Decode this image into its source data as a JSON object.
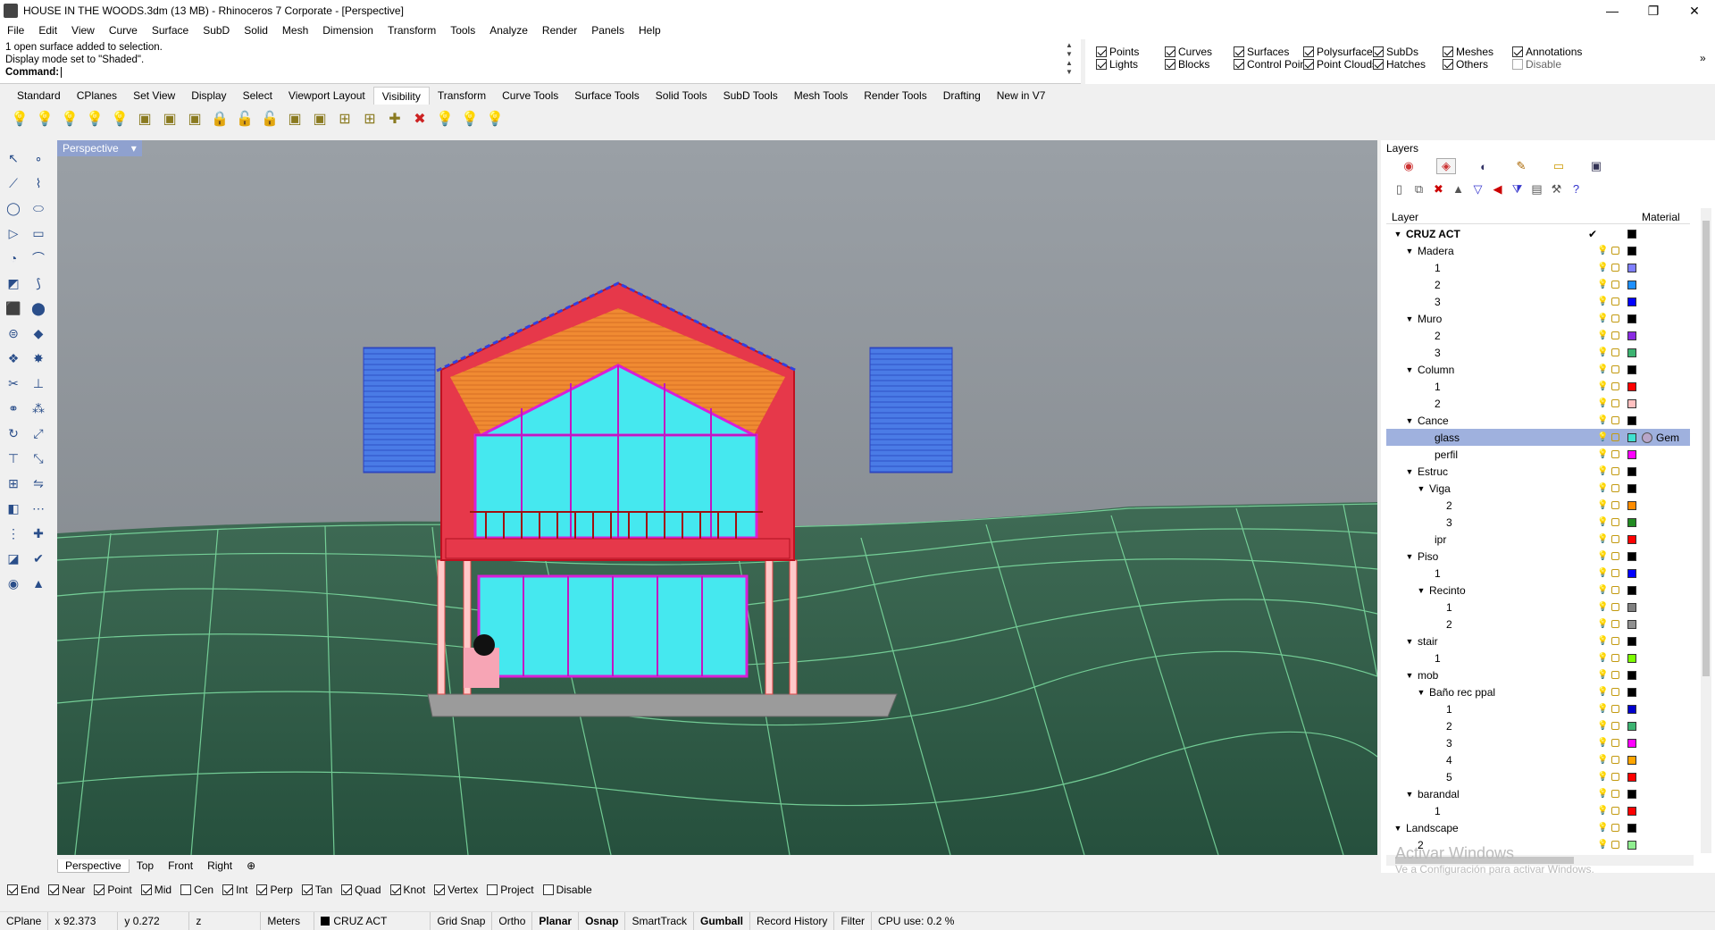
{
  "window": {
    "title": "HOUSE IN THE WOODS.3dm (13 MB) - Rhinoceros 7 Corporate - [Perspective]",
    "controls": [
      "—",
      "❐",
      "✕"
    ]
  },
  "menu": [
    "File",
    "Edit",
    "View",
    "Curve",
    "Surface",
    "SubD",
    "Solid",
    "Mesh",
    "Dimension",
    "Transform",
    "Tools",
    "Analyze",
    "Render",
    "Panels",
    "Help"
  ],
  "command": {
    "history": [
      "1 open surface added to selection.",
      "Display mode set to \"Shaded\"."
    ],
    "prompt": "Command:",
    "value": ""
  },
  "filters": [
    {
      "label": "Points",
      "checked": true
    },
    {
      "label": "Curves",
      "checked": true
    },
    {
      "label": "Surfaces",
      "checked": true
    },
    {
      "label": "Polysurfaces",
      "checked": true
    },
    {
      "label": "SubDs",
      "checked": true
    },
    {
      "label": "Meshes",
      "checked": true
    },
    {
      "label": "Annotations",
      "checked": true
    },
    {
      "label": "Lights",
      "checked": true
    },
    {
      "label": "Blocks",
      "checked": true
    },
    {
      "label": "Control Points",
      "checked": true
    },
    {
      "label": "Point Clouds",
      "checked": true
    },
    {
      "label": "Hatches",
      "checked": true
    },
    {
      "label": "Others",
      "checked": true
    },
    {
      "label": "Disable",
      "checked": false
    }
  ],
  "toolbar_tabs": [
    "Standard",
    "CPlanes",
    "Set View",
    "Display",
    "Select",
    "Viewport Layout",
    "Visibility",
    "Transform",
    "Curve Tools",
    "Surface Tools",
    "Solid Tools",
    "SubD Tools",
    "Mesh Tools",
    "Render Tools",
    "Drafting",
    "New in V7"
  ],
  "active_toolbar_tab": "Visibility",
  "viewport": {
    "label": "Perspective",
    "dropdown": "▾"
  },
  "viewport_tabs": [
    "Perspective",
    "Top",
    "Front",
    "Right",
    "⊕"
  ],
  "osnaps": [
    {
      "label": "End",
      "checked": true
    },
    {
      "label": "Near",
      "checked": true
    },
    {
      "label": "Point",
      "checked": true
    },
    {
      "label": "Mid",
      "checked": true
    },
    {
      "label": "Cen",
      "checked": false
    },
    {
      "label": "Int",
      "checked": true
    },
    {
      "label": "Perp",
      "checked": true
    },
    {
      "label": "Tan",
      "checked": true
    },
    {
      "label": "Quad",
      "checked": true
    },
    {
      "label": "Knot",
      "checked": true
    },
    {
      "label": "Vertex",
      "checked": true
    },
    {
      "label": "Project",
      "checked": false
    },
    {
      "label": "Disable",
      "checked": false
    }
  ],
  "status": {
    "cplane": "CPlane",
    "x": "x 92.373",
    "y": "y 0.272",
    "z": "z",
    "units": "Meters",
    "layer": "CRUZ ACT",
    "toggles": [
      "Grid Snap",
      "Ortho",
      "Planar",
      "Osnap",
      "SmartTrack",
      "Gumball",
      "Record History",
      "Filter"
    ],
    "bold_toggles": [
      "Planar",
      "Osnap",
      "Gumball"
    ],
    "cpu": "CPU use: 0.2 %"
  },
  "layers_panel": {
    "title": "Layers",
    "col_layer": "Layer",
    "col_material": "Material",
    "rows": [
      {
        "name": "CRUZ ACT",
        "depth": 0,
        "expander": "▼",
        "color": "#000000",
        "current": true,
        "bold": true
      },
      {
        "name": "Madera",
        "depth": 1,
        "expander": "▼",
        "color": "#000000"
      },
      {
        "name": "1",
        "depth": 2,
        "color": "#7f7fff"
      },
      {
        "name": "2",
        "depth": 2,
        "color": "#1e90ff"
      },
      {
        "name": "3",
        "depth": 2,
        "color": "#0000ff"
      },
      {
        "name": "Muro",
        "depth": 1,
        "expander": "▼",
        "color": "#000000"
      },
      {
        "name": "2",
        "depth": 2,
        "color": "#8a2be2"
      },
      {
        "name": "3",
        "depth": 2,
        "color": "#3cb371"
      },
      {
        "name": "Column",
        "depth": 1,
        "expander": "▼",
        "color": "#000000"
      },
      {
        "name": "1",
        "depth": 2,
        "color": "#ff0000"
      },
      {
        "name": "2",
        "depth": 2,
        "color": "#ffc0c0"
      },
      {
        "name": "Cance",
        "depth": 1,
        "expander": "▼",
        "color": "#000000"
      },
      {
        "name": "glass",
        "depth": 2,
        "color": "#40e0d0",
        "selected": true,
        "material": "Gem"
      },
      {
        "name": "perfil",
        "depth": 2,
        "color": "#ff00ff"
      },
      {
        "name": "Estruc",
        "depth": 1,
        "expander": "▼",
        "color": "#000000"
      },
      {
        "name": "Viga",
        "depth": 2,
        "expander": "▼",
        "color": "#000000"
      },
      {
        "name": "2",
        "depth": 3,
        "color": "#ff8c00"
      },
      {
        "name": "3",
        "depth": 3,
        "color": "#228b22"
      },
      {
        "name": "ipr",
        "depth": 2,
        "color": "#ff0000"
      },
      {
        "name": "Piso",
        "depth": 1,
        "expander": "▼",
        "color": "#000000"
      },
      {
        "name": "1",
        "depth": 2,
        "color": "#0000ff"
      },
      {
        "name": "Recinto",
        "depth": 2,
        "expander": "▼",
        "color": "#000000"
      },
      {
        "name": "1",
        "depth": 3,
        "color": "#808080"
      },
      {
        "name": "2",
        "depth": 3,
        "color": "#909090"
      },
      {
        "name": "stair",
        "depth": 1,
        "expander": "▼",
        "color": "#000000"
      },
      {
        "name": "1",
        "depth": 2,
        "color": "#7cfc00"
      },
      {
        "name": "mob",
        "depth": 1,
        "expander": "▼",
        "color": "#000000"
      },
      {
        "name": "Baño rec ppal",
        "depth": 2,
        "expander": "▼",
        "color": "#000000"
      },
      {
        "name": "1",
        "depth": 3,
        "color": "#0000cd"
      },
      {
        "name": "2",
        "depth": 3,
        "color": "#3cb371"
      },
      {
        "name": "3",
        "depth": 3,
        "color": "#ff00ff"
      },
      {
        "name": "4",
        "depth": 3,
        "color": "#ffa500"
      },
      {
        "name": "5",
        "depth": 3,
        "color": "#ff0000"
      },
      {
        "name": "barandal",
        "depth": 1,
        "expander": "▼",
        "color": "#000000"
      },
      {
        "name": "1",
        "depth": 2,
        "color": "#ff0000"
      },
      {
        "name": "Landscape",
        "depth": 0,
        "expander": "▼",
        "color": "#000000"
      },
      {
        "name": "2",
        "depth": 1,
        "color": "#90ee90"
      }
    ]
  },
  "watermark": {
    "line1": "Activar Windows",
    "line2": "Ve a Configuración para activar Windows."
  }
}
